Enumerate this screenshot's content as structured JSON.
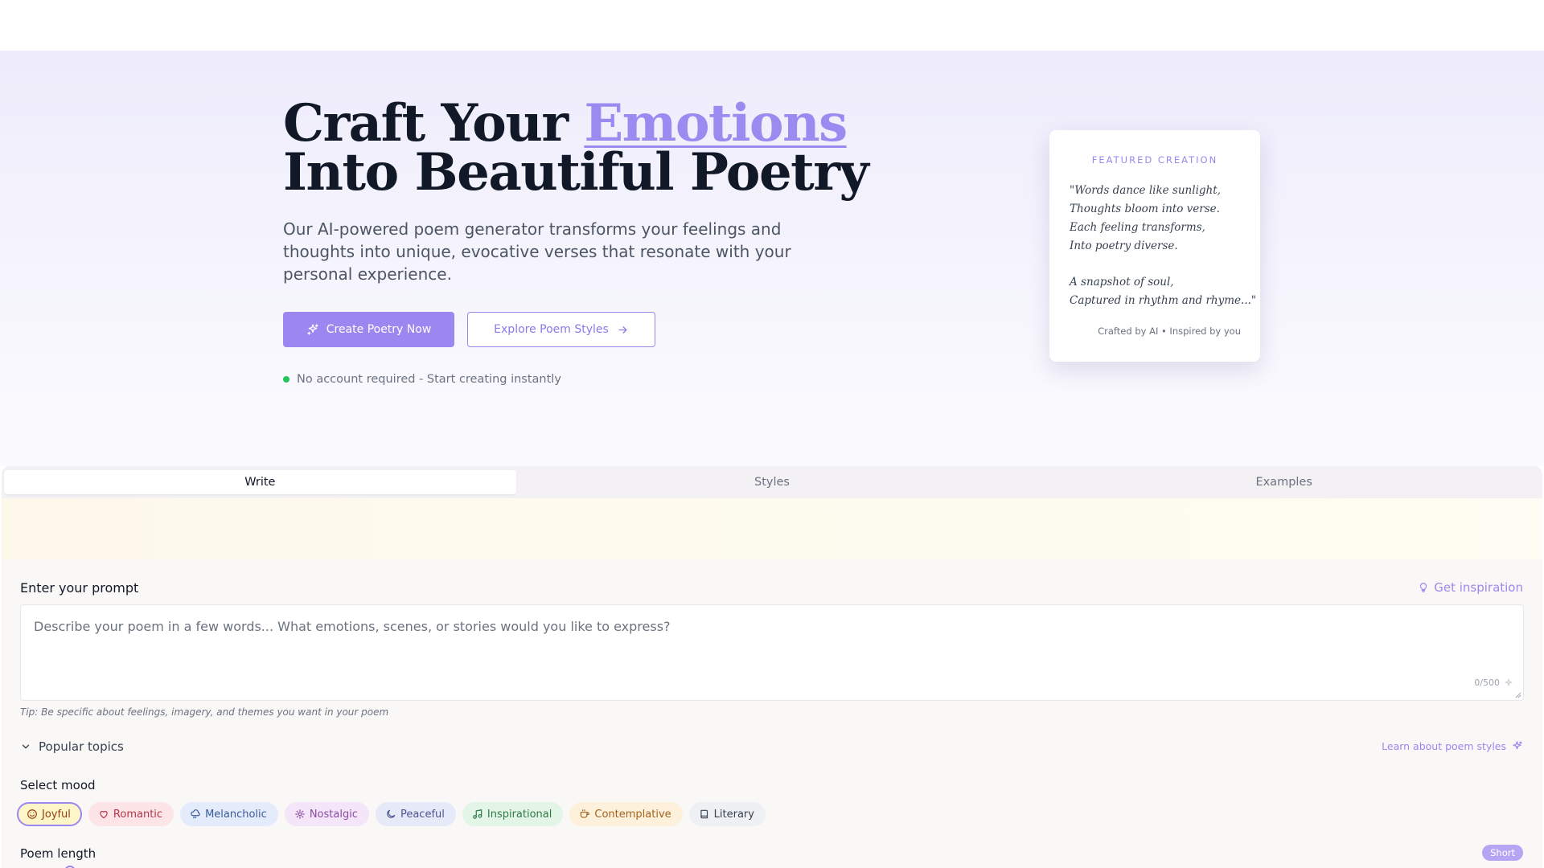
{
  "hero": {
    "headline_line1_prefix": "Craft Your ",
    "headline_accent": "Emotions",
    "headline_line2": "Into Beautiful Poetry",
    "subtitle": "Our AI-powered poem generator transforms your feelings and thoughts into unique, evocative verses that resonate with your personal experience.",
    "primary_button": "Create Poetry Now",
    "secondary_button": "Explore Poem Styles",
    "no_account": "No account required - Start creating instantly"
  },
  "featured": {
    "label": "FEATURED CREATION",
    "stanza1": [
      "\"Words dance like sunlight,",
      "Thoughts bloom into verse.",
      "Each feeling transforms,",
      "Into poetry diverse."
    ],
    "stanza2": [
      "A snapshot of soul,",
      "Captured in rhythm and rhyme...\""
    ],
    "credit": "Crafted by AI • Inspired by you"
  },
  "tabs": [
    {
      "label": "Write",
      "active": true
    },
    {
      "label": "Styles",
      "active": false
    },
    {
      "label": "Examples",
      "active": false
    }
  ],
  "prompt": {
    "label": "Enter your prompt",
    "inspiration": "Get inspiration",
    "placeholder": "Describe your poem in a few words... What emotions, scenes, or stories would you like to express?",
    "value": "",
    "counter": "0/500",
    "tip": "Tip: Be specific about feelings, imagery, and themes you want in your poem"
  },
  "topics": {
    "label": "Popular topics",
    "learn": "Learn about poem styles"
  },
  "mood": {
    "label": "Select mood",
    "options": [
      {
        "label": "Joyful",
        "icon": "smile-icon",
        "bg": "#fef5c8",
        "fg": "#92400e",
        "selected": true
      },
      {
        "label": "Romantic",
        "icon": "heart-icon",
        "bg": "#fde4e6",
        "fg": "#b4344a",
        "selected": false
      },
      {
        "label": "Melancholic",
        "icon": "cloud-rain-icon",
        "bg": "#e4ecfb",
        "fg": "#3b5b9a",
        "selected": false
      },
      {
        "label": "Nostalgic",
        "icon": "sparkle-icon",
        "bg": "#f4e6f8",
        "fg": "#8a4aa3",
        "selected": false
      },
      {
        "label": "Peaceful",
        "icon": "moon-icon",
        "bg": "#e6e9f8",
        "fg": "#4b5590",
        "selected": false
      },
      {
        "label": "Inspirational",
        "icon": "music-icon",
        "bg": "#e3f5e6",
        "fg": "#2f7a45",
        "selected": false
      },
      {
        "label": "Contemplative",
        "icon": "coffee-icon",
        "bg": "#fdf1dc",
        "fg": "#a4611c",
        "selected": false
      },
      {
        "label": "Literary",
        "icon": "book-icon",
        "bg": "#eef0f3",
        "fg": "#374151",
        "selected": false
      }
    ]
  },
  "length": {
    "label": "Poem length",
    "value": "Short"
  },
  "colors": {
    "accent": "#9b87ef",
    "success": "#22c55e"
  }
}
